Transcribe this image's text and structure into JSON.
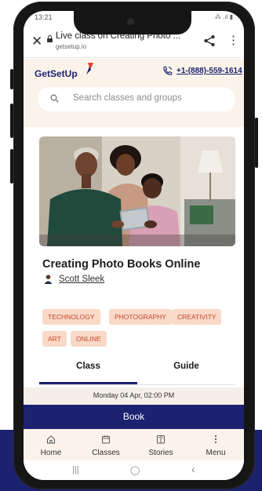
{
  "status_bar": {
    "time": "13:21",
    "icons": "⁂ .ıl ▮"
  },
  "browser": {
    "tab_title": "Live class on Creating Photo ...",
    "url": "getsetup.io",
    "close_icon": "close-icon",
    "share_icon": "share-icon",
    "menu_icon": "more-vert-icon"
  },
  "header": {
    "logo_text": "GetSetUp",
    "phone_number": "+1-(888)-559-1614",
    "phone_icon": "phone-icon",
    "accent": "#1c2170",
    "logo_mark_colors": [
      "#e8402a",
      "#1c2170"
    ]
  },
  "search": {
    "placeholder": "Search classes and groups"
  },
  "class": {
    "title": "Creating Photo Books Online",
    "instructor": "Scott Sleek",
    "tags": [
      "TECHNOLOGY",
      "PHOTOGRAPHY",
      "CREATIVITY",
      "ART",
      "ONLINE"
    ],
    "tag_color": "#c7462d",
    "tag_bg": "#f9d9c7"
  },
  "tabs": {
    "class_label": "Class",
    "guide_label": "Guide",
    "active": "Class"
  },
  "session": {
    "date_text": "Monday 04 Apr, 02:00 PM",
    "book_label": "Book"
  },
  "bottom_nav": [
    {
      "label": "Home",
      "icon": "home-icon"
    },
    {
      "label": "Classes",
      "icon": "calendar-icon"
    },
    {
      "label": "Stories",
      "icon": "book-icon"
    },
    {
      "label": "Menu",
      "icon": "more-vert-icon"
    }
  ],
  "system_nav": {
    "recents": "|||",
    "home": "◯",
    "back": "‹"
  }
}
